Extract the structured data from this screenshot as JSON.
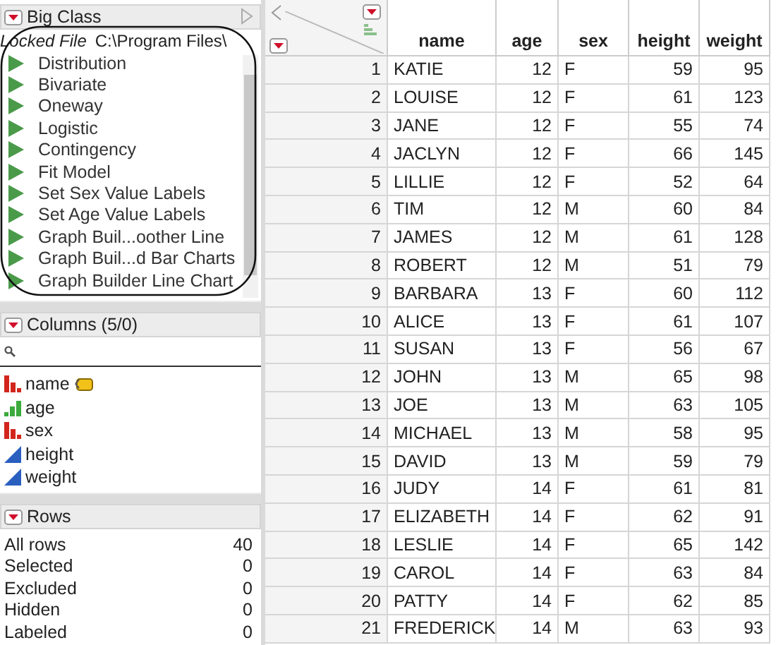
{
  "table_panel": {
    "title": "Big Class",
    "locked_label": "Locked File",
    "path": "C:\\Program Files\\",
    "scripts": [
      "Distribution",
      "Bivariate",
      "Oneway",
      "Logistic",
      "Contingency",
      "Fit Model",
      "Set Sex Value Labels",
      "Set Age Value Labels",
      "Graph Buil...oother Line",
      "Graph Buil...d Bar Charts",
      "Graph Builder Line Chart"
    ]
  },
  "columns_panel": {
    "title": "Columns (5/0)",
    "columns": [
      {
        "name": "name",
        "kind": "nominal",
        "labeled": true
      },
      {
        "name": "age",
        "kind": "ordinal",
        "labeled": false
      },
      {
        "name": "sex",
        "kind": "nominal",
        "labeled": false
      },
      {
        "name": "height",
        "kind": "continuous",
        "labeled": false
      },
      {
        "name": "weight",
        "kind": "continuous",
        "labeled": false
      }
    ]
  },
  "rows_panel": {
    "title": "Rows",
    "stats": [
      {
        "label": "All rows",
        "value": "40"
      },
      {
        "label": "Selected",
        "value": "0"
      },
      {
        "label": "Excluded",
        "value": "0"
      },
      {
        "label": "Hidden",
        "value": "0"
      },
      {
        "label": "Labeled",
        "value": "0"
      }
    ]
  },
  "table": {
    "columns": [
      {
        "name": "name",
        "kind": "character"
      },
      {
        "name": "age",
        "kind": "numeric"
      },
      {
        "name": "sex",
        "kind": "character"
      },
      {
        "name": "height",
        "kind": "numeric"
      },
      {
        "name": "weight",
        "kind": "numeric"
      }
    ],
    "rows": [
      {
        "row": "1",
        "cells": [
          "KATIE",
          "12",
          "F",
          "59",
          "95"
        ]
      },
      {
        "row": "2",
        "cells": [
          "LOUISE",
          "12",
          "F",
          "61",
          "123"
        ]
      },
      {
        "row": "3",
        "cells": [
          "JANE",
          "12",
          "F",
          "55",
          "74"
        ]
      },
      {
        "row": "4",
        "cells": [
          "JACLYN",
          "12",
          "F",
          "66",
          "145"
        ]
      },
      {
        "row": "5",
        "cells": [
          "LILLIE",
          "12",
          "F",
          "52",
          "64"
        ]
      },
      {
        "row": "6",
        "cells": [
          "TIM",
          "12",
          "M",
          "60",
          "84"
        ]
      },
      {
        "row": "7",
        "cells": [
          "JAMES",
          "12",
          "M",
          "61",
          "128"
        ]
      },
      {
        "row": "8",
        "cells": [
          "ROBERT",
          "12",
          "M",
          "51",
          "79"
        ]
      },
      {
        "row": "9",
        "cells": [
          "BARBARA",
          "13",
          "F",
          "60",
          "112"
        ]
      },
      {
        "row": "10",
        "cells": [
          "ALICE",
          "13",
          "F",
          "61",
          "107"
        ]
      },
      {
        "row": "11",
        "cells": [
          "SUSAN",
          "13",
          "F",
          "56",
          "67"
        ]
      },
      {
        "row": "12",
        "cells": [
          "JOHN",
          "13",
          "M",
          "65",
          "98"
        ]
      },
      {
        "row": "13",
        "cells": [
          "JOE",
          "13",
          "M",
          "63",
          "105"
        ]
      },
      {
        "row": "14",
        "cells": [
          "MICHAEL",
          "13",
          "M",
          "58",
          "95"
        ]
      },
      {
        "row": "15",
        "cells": [
          "DAVID",
          "13",
          "M",
          "59",
          "79"
        ]
      },
      {
        "row": "16",
        "cells": [
          "JUDY",
          "14",
          "F",
          "61",
          "81"
        ]
      },
      {
        "row": "17",
        "cells": [
          "ELIZABETH",
          "14",
          "F",
          "62",
          "91"
        ]
      },
      {
        "row": "18",
        "cells": [
          "LESLIE",
          "14",
          "F",
          "65",
          "142"
        ]
      },
      {
        "row": "19",
        "cells": [
          "CAROL",
          "14",
          "F",
          "63",
          "84"
        ]
      },
      {
        "row": "20",
        "cells": [
          "PATTY",
          "14",
          "F",
          "62",
          "85"
        ]
      },
      {
        "row": "21",
        "cells": [
          "FREDERICK",
          "14",
          "M",
          "63",
          "93"
        ]
      }
    ]
  }
}
